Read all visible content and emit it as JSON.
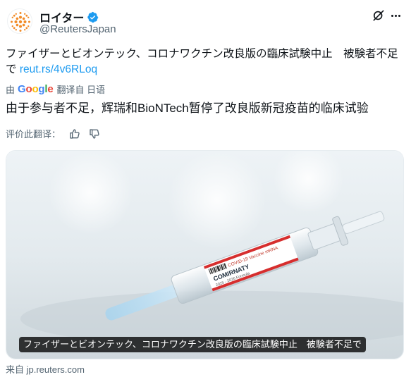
{
  "account": {
    "display_name": "ロイター",
    "handle": "@ReutersJapan",
    "verified": true
  },
  "tweet": {
    "text": "ファイザーとビオンテック、コロナワクチン改良版の臨床試験中止　被験者不足で ",
    "link": "reut.rs/4v6RLoq"
  },
  "translation": {
    "prefix": "由",
    "provider": [
      "G",
      "o",
      "o",
      "g",
      "l",
      "e"
    ],
    "suffix": "翻译自 日语",
    "text": "由于参与者不足，辉瑞和BioNTech暂停了改良版新冠疫苗的临床试验"
  },
  "rating": {
    "label": "评价此翻译："
  },
  "media": {
    "caption": "ファイザーとビオンテック、コロナワクチン改良版の臨床試験中止　被験者不足で",
    "vial_lines": [
      "COVID-19 Vaccine mRNA",
      "COMIRNATY",
      "2025 - 2026 Formula"
    ]
  },
  "source": {
    "label": "来自 jp.reuters.com"
  },
  "colors": {
    "link": "#1d9bf0",
    "verified": "#1d9bf0",
    "text": "#0f1419",
    "secondary": "#536471",
    "reuters_orange": "#f28c28"
  },
  "icons": [
    "reuters-logo-icon",
    "verified-badge-icon",
    "grok-icon",
    "more-icon",
    "thumbs-up-icon",
    "thumbs-down-icon"
  ]
}
